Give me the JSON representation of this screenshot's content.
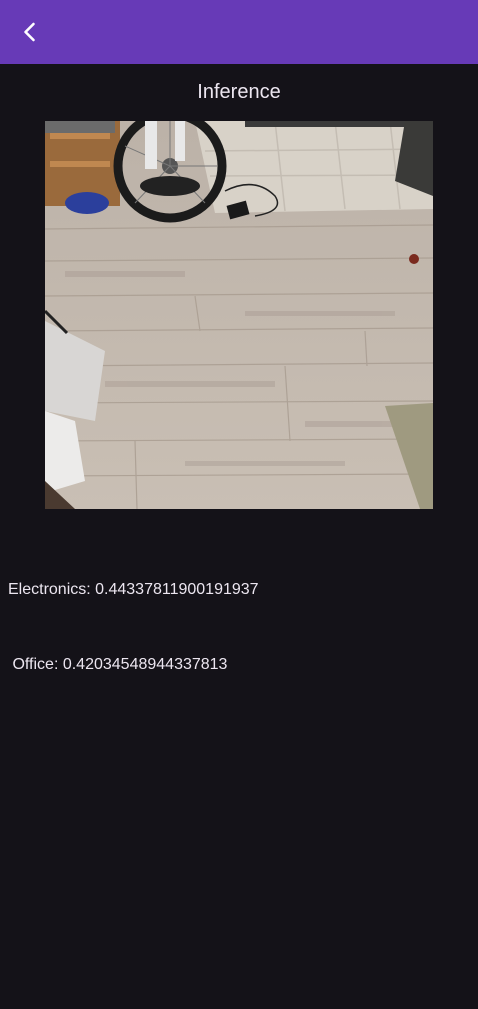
{
  "app_bar": {
    "color": "#673ab7",
    "back_icon": "chevron-left-icon"
  },
  "page": {
    "title": "Inference"
  },
  "image": {
    "description_icon": "photo-floor-bicycle"
  },
  "results": [
    {
      "text": "Electronics: 0.44337811900191937"
    },
    {
      "text": " Office: 0.42034548944337813"
    }
  ]
}
